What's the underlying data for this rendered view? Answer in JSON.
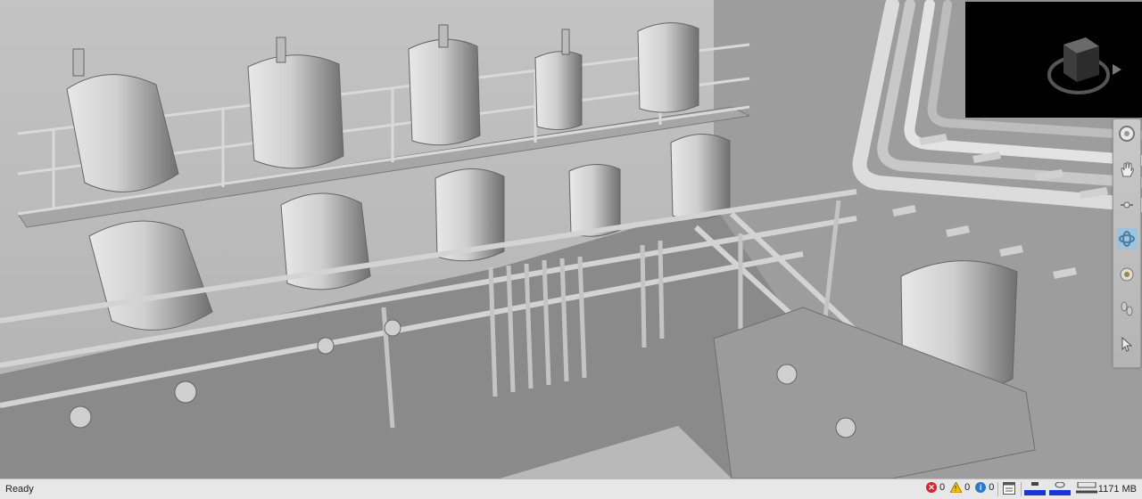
{
  "status": {
    "ready_text": "Ready",
    "errors_count": "0",
    "warnings_count": "0",
    "info_count": "0",
    "memory_text": "1171 MB"
  },
  "colors": {
    "viewport_bg": "#8f8f8f",
    "viewcube_bg": "#000000",
    "nav_active": "#9fc3da",
    "error_red": "#d6262d",
    "warning_yellow": "#f2c019",
    "info_blue": "#2f78c8",
    "status_blue": "#1b34d8"
  },
  "icons": {
    "viewcube": "viewcube-icon",
    "navbar": [
      "steering-wheel-icon",
      "pan-hand-icon",
      "zoom-icon",
      "orbit-icon",
      "look-icon",
      "walk-icon",
      "select-icon"
    ],
    "statusbar": [
      "error-icon",
      "warning-icon",
      "info-icon",
      "panel-icon",
      "progress-icon",
      "memory-icon",
      "network-icon"
    ]
  }
}
